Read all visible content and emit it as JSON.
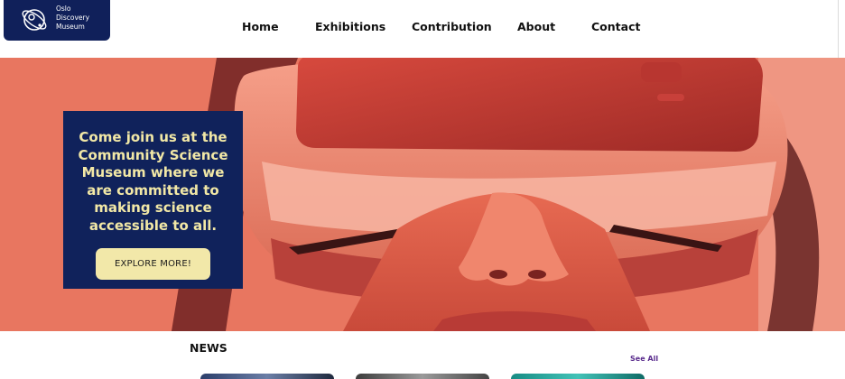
{
  "header": {
    "logo_lines": [
      "Oslo",
      "Discovery",
      "Museum"
    ],
    "nav": [
      "Home",
      "Exhibitions",
      "Contribution",
      "About",
      "Contact"
    ]
  },
  "hero": {
    "image_desc_icon": "vr-headset-photo",
    "promo_text": "Come join us at the Community Science Museum where we are committed to making science accessible to all.",
    "cta_label": "EXPLORE MORE!"
  },
  "news": {
    "title": "NEWS",
    "see_all_label": "See All"
  },
  "colors": {
    "navy": "#10225b",
    "cream": "#f2e8a9",
    "hero_red": "#e86e55",
    "link_purple": "#5b2d8e"
  }
}
